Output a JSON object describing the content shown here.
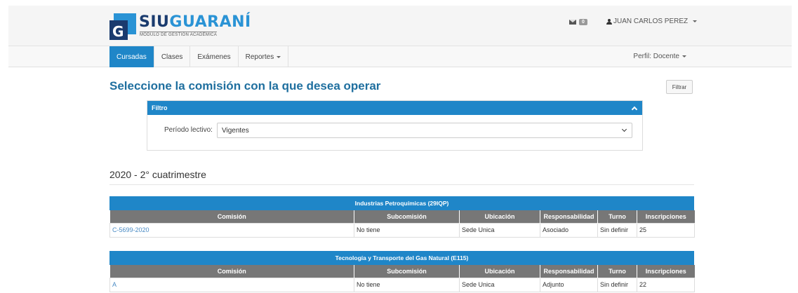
{
  "header": {
    "logo_siu": "SIU",
    "logo_guarani": "GUARANÍ",
    "logo_subtitle": "MÓDULO DE GESTIÓN ACADÉMICA",
    "mail_count": "0",
    "user_name": "JUAN CARLOS PEREZ"
  },
  "nav": {
    "items": [
      "Cursadas",
      "Clases",
      "Exámenes",
      "Reportes"
    ],
    "perfil": "Perfil: Docente"
  },
  "main": {
    "title": "Seleccione la comisión con la que desea operar",
    "filter_button": "Filtrar",
    "filter": {
      "header": "Filtro",
      "label": "Período lectivo:",
      "selected": "Vigentes"
    },
    "period": "2020 - 2° cuatrimestre",
    "columns": [
      "Comisión",
      "Subcomisión",
      "Ubicación",
      "Responsabilidad",
      "Turno",
      "Inscripciones"
    ],
    "subjects": [
      {
        "name": "Industrias Petroquímicas (29IQP)",
        "rows": [
          {
            "comision": "C-5699-2020",
            "subcomision": "No tiene",
            "ubicacion": "Sede Unica",
            "responsabilidad": "Asociado",
            "turno": "Sin definir",
            "inscripciones": "25"
          }
        ]
      },
      {
        "name": "Tecnología y Transporte del Gas Natural (E115)",
        "rows": [
          {
            "comision": "A",
            "subcomision": "No tiene",
            "ubicacion": "Sede Unica",
            "responsabilidad": "Adjunto",
            "turno": "Sin definir",
            "inscripciones": "22"
          }
        ]
      }
    ]
  },
  "colors": {
    "primary": "#1f86c8",
    "header_gray": "#777777",
    "title_blue": "#1f6f9f",
    "link": "#4a8bc4"
  }
}
